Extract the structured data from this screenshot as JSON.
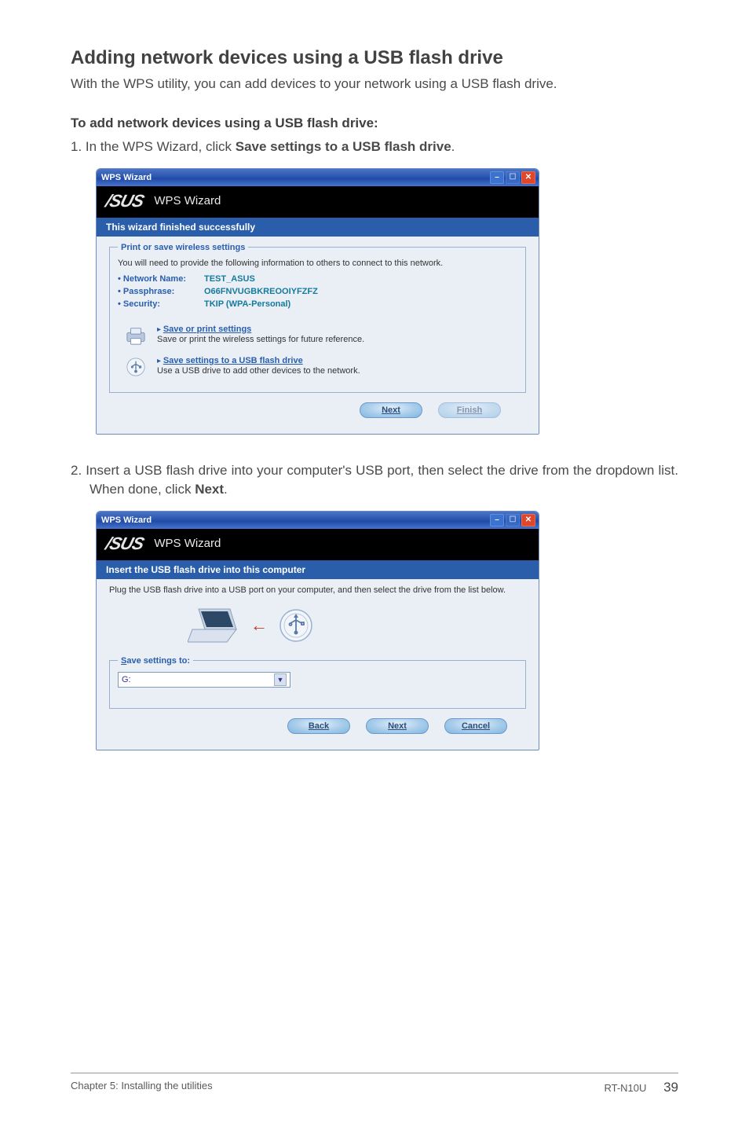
{
  "page": {
    "section_title": "Adding network devices using a USB flash drive",
    "intro": "With the WPS utility, you can add devices to your network using a USB flash drive.",
    "sub_title": "To add network devices using a USB flash drive:",
    "step1_prefix": "1.   In the WPS Wizard, click ",
    "step1_bold": "Save settings to a USB flash drive",
    "step1_suffix": ".",
    "step2_prefix": "2.   Insert a USB flash drive into your computer's USB port, then select the drive from the dropdown list. When done, click ",
    "step2_bold": "Next",
    "step2_suffix": "."
  },
  "win1": {
    "titlebar": "WPS Wizard",
    "header_title": "WPS Wizard",
    "banner": "This wizard finished successfully",
    "fs_legend": "Print or save wireless settings",
    "desc": "You will need to provide the following information to others to connect to this network.",
    "rows": [
      {
        "k": "• Network Name:",
        "v": "TEST_ASUS"
      },
      {
        "k": "• Passphrase:",
        "v": "O66FNVUGBKREOOIYFZFZ"
      },
      {
        "k": "• Security:",
        "v": "TKIP (WPA-Personal)"
      }
    ],
    "action1_link": "Save or print settings",
    "action1_sub": "Save or print the wireless settings for future reference.",
    "action2_link": "Save settings to a USB flash drive",
    "action2_sub": "Use a USB drive to add other devices to the network.",
    "next": "Next",
    "finish": "Finish"
  },
  "win2": {
    "titlebar": "WPS Wizard",
    "header_title": "WPS Wizard",
    "banner": "Insert the USB flash drive into this computer",
    "desc": "Plug the USB flash drive into a USB port on your computer, and then select the drive from the list below.",
    "fs_legend": "Save settings to:",
    "drop_value": "G:",
    "back": "Back",
    "next": "Next",
    "cancel": "Cancel"
  },
  "footer": {
    "left": "Chapter 5: Installing the utilities",
    "product": "RT-N10U",
    "pageno": "39"
  }
}
